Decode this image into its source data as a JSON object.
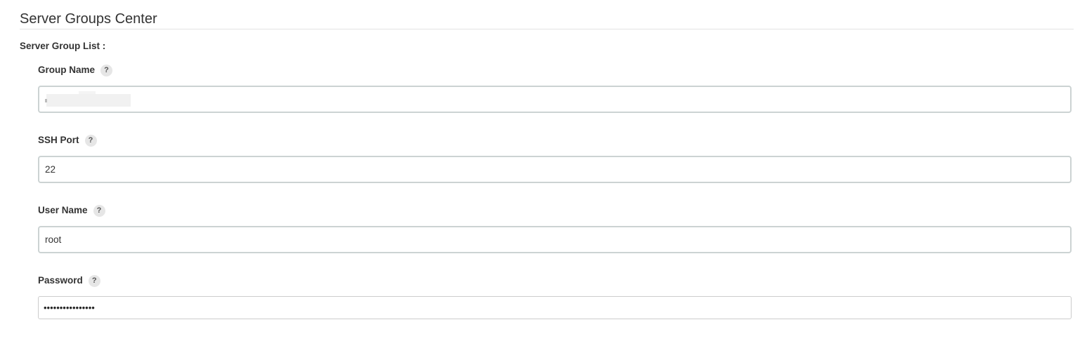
{
  "page": {
    "title": "Server Groups Center",
    "section_label": "Server Group List :"
  },
  "fields": {
    "group_name": {
      "label": "Group Name",
      "help_icon": "?",
      "value": ""
    },
    "ssh_port": {
      "label": "SSH Port",
      "help_icon": "?",
      "value": "22"
    },
    "user_name": {
      "label": "User Name",
      "help_icon": "?",
      "value": "root"
    },
    "password": {
      "label": "Password",
      "help_icon": "?",
      "value": "••••••••••••••••"
    }
  },
  "colors": {
    "text": "#333333",
    "input_border": "#ccd3d3",
    "help_badge_bg": "#e6e6e6"
  }
}
